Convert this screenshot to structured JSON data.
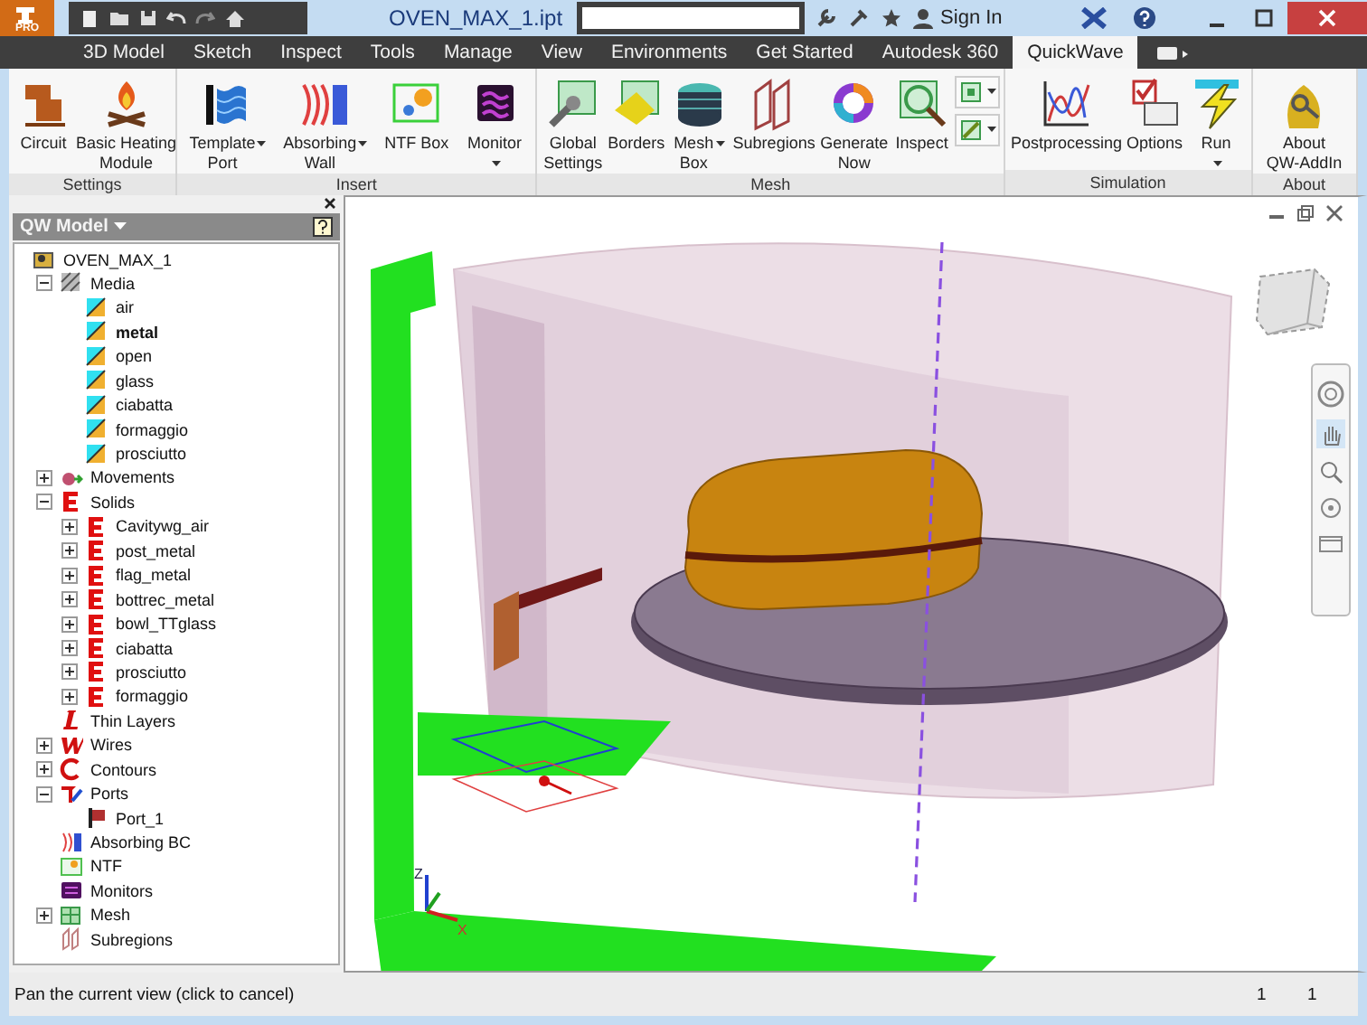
{
  "title_bar": {
    "app_badge": "PRO",
    "document_title": "OVEN_MAX_1.ipt",
    "sign_in": "Sign In"
  },
  "ribbon_tabs": [
    {
      "label": "3D Model",
      "selected": false
    },
    {
      "label": "Sketch",
      "selected": false
    },
    {
      "label": "Inspect",
      "selected": false
    },
    {
      "label": "Tools",
      "selected": false
    },
    {
      "label": "Manage",
      "selected": false
    },
    {
      "label": "View",
      "selected": false
    },
    {
      "label": "Environments",
      "selected": false
    },
    {
      "label": "Get Started",
      "selected": false
    },
    {
      "label": "Autodesk 360",
      "selected": false
    },
    {
      "label": "QuickWave",
      "selected": true
    }
  ],
  "ribbon_groups": [
    {
      "label": "Settings",
      "buttons": [
        {
          "kind": "large",
          "label": "Circuit",
          "dropdown": false
        },
        {
          "kind": "large",
          "label": "Basic Heating\nModule",
          "dropdown": false
        }
      ]
    },
    {
      "label": "Insert",
      "buttons": [
        {
          "kind": "large",
          "label": "Template\nPort",
          "dropdown": true
        },
        {
          "kind": "large",
          "label": "Absorbing\nWall",
          "dropdown": true
        },
        {
          "kind": "large",
          "label": "NTF Box",
          "dropdown": false
        },
        {
          "kind": "large",
          "label": "Monitor",
          "dropdown": true
        }
      ]
    },
    {
      "label": "Mesh",
      "buttons": [
        {
          "kind": "large",
          "label": "Global\nSettings",
          "dropdown": false
        },
        {
          "kind": "large",
          "label": "Borders",
          "dropdown": false
        },
        {
          "kind": "large",
          "label": "Mesh\nBox",
          "dropdown": true
        },
        {
          "kind": "large",
          "label": "Subregions",
          "dropdown": false
        },
        {
          "kind": "large",
          "label": "Generate\nNow",
          "dropdown": false
        },
        {
          "kind": "large",
          "label": "Inspect",
          "dropdown": false
        },
        {
          "kind": "small_stack"
        }
      ]
    },
    {
      "label": "Simulation",
      "buttons": [
        {
          "kind": "large",
          "label": "Postprocessing",
          "dropdown": false
        },
        {
          "kind": "large",
          "label": "Options",
          "dropdown": false
        },
        {
          "kind": "large",
          "label": "Run",
          "dropdown": true
        }
      ]
    },
    {
      "label": "About",
      "buttons": [
        {
          "kind": "large",
          "label": "About\nQW-AddIn",
          "dropdown": false
        }
      ]
    }
  ],
  "model_tree": {
    "header": "QW Model",
    "items": [
      {
        "label": "OVEN_MAX_1",
        "kind": "model",
        "children": [
          {
            "label": "Media",
            "kind": "media",
            "expanded": true,
            "children": [
              {
                "label": "air",
                "kind": "medium",
                "active": false
              },
              {
                "label": "metal",
                "kind": "medium",
                "active": true
              },
              {
                "label": "open",
                "kind": "medium",
                "active": false
              },
              {
                "label": "glass",
                "kind": "medium",
                "active": false
              },
              {
                "label": "ciabatta",
                "kind": "medium",
                "active": false
              },
              {
                "label": "formaggio",
                "kind": "medium",
                "active": false
              },
              {
                "label": "prosciutto",
                "kind": "medium",
                "active": false
              }
            ]
          },
          {
            "label": "Movements",
            "kind": "movement",
            "expanded": false
          },
          {
            "label": "Solids",
            "kind": "solid",
            "expanded": true,
            "children": [
              {
                "label": "Cavitywg_air",
                "kind": "solid",
                "expanded": false
              },
              {
                "label": "post_metal",
                "kind": "solid",
                "expanded": false
              },
              {
                "label": "flag_metal",
                "kind": "solid",
                "expanded": false
              },
              {
                "label": "bottrec_metal",
                "kind": "solid",
                "expanded": false
              },
              {
                "label": "bowl_TTglass",
                "kind": "solid",
                "expanded": false
              },
              {
                "label": "ciabatta",
                "kind": "solid",
                "expanded": false
              },
              {
                "label": "prosciutto",
                "kind": "solid",
                "expanded": false
              },
              {
                "label": "formaggio",
                "kind": "solid",
                "expanded": false
              }
            ]
          },
          {
            "label": "Thin Layers",
            "kind": "thin_layer"
          },
          {
            "label": "Wires",
            "kind": "wire",
            "expanded": false
          },
          {
            "label": "Contours",
            "kind": "contour",
            "expanded": false
          },
          {
            "label": "Ports",
            "kind": "port",
            "expanded": true,
            "children": [
              {
                "label": "Port_1",
                "kind": "port_item"
              }
            ]
          },
          {
            "label": "Absorbing BC",
            "kind": "absorbing"
          },
          {
            "label": "NTF",
            "kind": "ntf"
          },
          {
            "label": "Monitors",
            "kind": "monitor"
          },
          {
            "label": "Mesh",
            "kind": "mesh",
            "expanded": false
          },
          {
            "label": "Subregions",
            "kind": "subregion"
          }
        ]
      }
    ]
  },
  "viewport": {
    "triad_labels": [
      "Z",
      "X"
    ]
  },
  "status_bar": {
    "message": "Pan the current view (click to cancel)",
    "fields": [
      "1",
      "1"
    ]
  }
}
